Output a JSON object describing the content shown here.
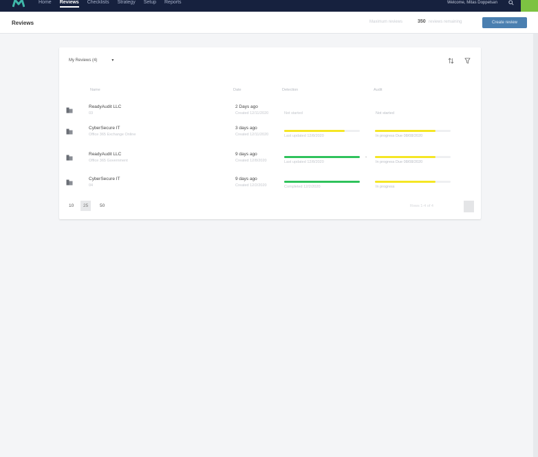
{
  "nav": {
    "items": [
      {
        "label": "Home",
        "active": false
      },
      {
        "label": "Reviews",
        "active": true
      },
      {
        "label": "Checklists",
        "active": false
      },
      {
        "label": "Strategy",
        "active": false
      },
      {
        "label": "Setup",
        "active": false
      },
      {
        "label": "Reports",
        "active": false
      }
    ],
    "welcome": "Welcome, Mitas Doppelsan",
    "accent_color": "#7cc242",
    "bar_color": "#16213e"
  },
  "header": {
    "title": "Reviews",
    "summary_label": "Maximum reviews",
    "summary_value": "350",
    "summary_label_2": "reviews remaining",
    "create_button": "Create review",
    "button_color": "#4a7fb0"
  },
  "list": {
    "filter_label": "My Reviews (4)",
    "columns": [
      "Name",
      "Date",
      "Detection",
      "Audit"
    ],
    "rows": [
      {
        "name": "ReadyAudit LLC",
        "sub": "03",
        "time": "2 Days ago",
        "created": "Created 12/11/2020",
        "det_caption": "Not started",
        "det_progress": 0,
        "det_color": "",
        "audit_caption": "Not started",
        "audit_progress": 0,
        "audit_color": "",
        "expanded_caret": false
      },
      {
        "name": "CyberSecure IT",
        "sub": "Office 365 Exchange Online",
        "time": "3 days ago",
        "created": "Created 12/11/2020",
        "det_caption": "Last updated 12/8/2020",
        "det_progress": 0.8,
        "det_color": "#f5e623",
        "audit_caption": "In progress Due 08/08/2020",
        "audit_progress": 0.8,
        "audit_color": "#f5e623",
        "expanded_caret": false
      },
      {
        "name": "ReadyAudit LLC",
        "sub": "Office 365 Government",
        "time": "9 days ago",
        "created": "Created 12/8/2020",
        "det_caption": "Last updated 12/8/2020",
        "det_progress": 1.0,
        "det_color": "#2ec25a",
        "audit_caption": "In progress Due 08/08/2020",
        "audit_progress": 0.8,
        "audit_color": "#f5e623",
        "expanded_caret": true
      },
      {
        "name": "CyberSecure IT",
        "sub": "04",
        "time": "9 days ago",
        "created": "Created 12/2/2020",
        "det_caption": "Completed 12/2/2020",
        "det_progress": 1.0,
        "det_color": "#2ec25a",
        "audit_caption": "In progress",
        "audit_progress": 0.8,
        "audit_color": "#f5e623",
        "expanded_caret": false
      }
    ],
    "pager": {
      "sizes": [
        "10",
        "25",
        "50"
      ],
      "selected": "25",
      "range": "Rows 1-4 of 4"
    }
  }
}
